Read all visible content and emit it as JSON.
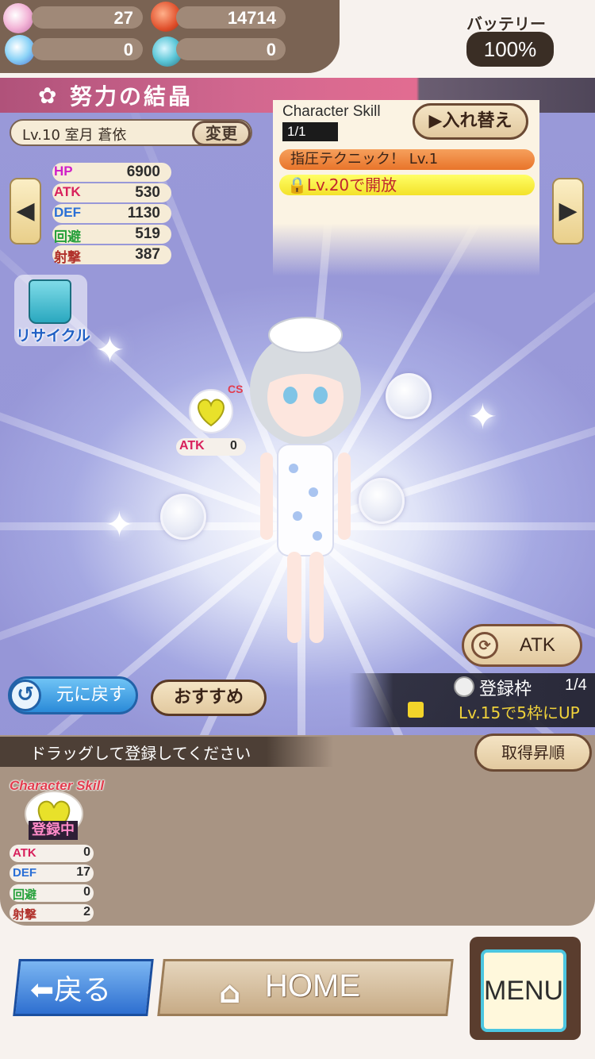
{
  "currency": {
    "gems": "27",
    "coins": "14714",
    "crystals": "0",
    "stones": "0"
  },
  "battery": {
    "label": "バッテリー",
    "value": "100%"
  },
  "screen": {
    "title": "努力の結晶"
  },
  "character": {
    "name": "Lv.10 室月 蒼依",
    "change_label": "変更"
  },
  "stats": [
    {
      "name": "HP",
      "value": "6900",
      "color": "#d020c8"
    },
    {
      "name": "ATK",
      "value": "530",
      "color": "#d8205c"
    },
    {
      "name": "DEF",
      "value": "1130",
      "color": "#2a6fd6"
    },
    {
      "name": "回避",
      "value": "519",
      "color": "#25a03a"
    },
    {
      "name": "射撃",
      "value": "387",
      "color": "#b0302a"
    }
  ],
  "skill": {
    "title": "Character Skill",
    "count": "1/1",
    "swap_label": "▶入れ替え",
    "name": "指圧テクニック！ Lv.1",
    "lock_text": "Lv.20で開放"
  },
  "recycle": {
    "label": "リサイクル"
  },
  "equipped_gem": {
    "badge": "CS",
    "stat_name": "ATK",
    "stat_value": "0"
  },
  "atk_button": {
    "label": "ATK"
  },
  "registration": {
    "label": "登録枠",
    "count": "1/4",
    "note": "Lv.15で5枠にUP"
  },
  "revert_button": {
    "label": "元に戻す"
  },
  "recommend_button": {
    "label": "おすすめ"
  },
  "inventory": {
    "hint": "ドラッグして登録してください",
    "sort_label": "取得昇順",
    "items": [
      {
        "type_label": "Character Skill",
        "status": "登録中",
        "stats": [
          {
            "name": "ATK",
            "value": "0",
            "color": "#d8205c"
          },
          {
            "name": "DEF",
            "value": "17",
            "color": "#2a6fd6"
          },
          {
            "name": "回避",
            "value": "0",
            "color": "#25a03a"
          },
          {
            "name": "射撃",
            "value": "2",
            "color": "#b0302a"
          }
        ]
      }
    ]
  },
  "footer": {
    "back_label": "戻る",
    "home_label": "HOME",
    "menu_label": "MENU"
  },
  "colors": {
    "brown": "#7a6353",
    "pink_header": "#d1678f",
    "gold_text": "#f0d23a",
    "blue_button": "#2a8ad8"
  }
}
